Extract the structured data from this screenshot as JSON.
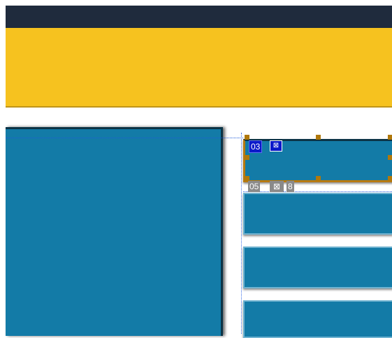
{
  "labels": {
    "selected_id": "03",
    "selected_icon": "image-icon",
    "next_id": "05",
    "next_icon": "image-icon",
    "next_suffix": "8"
  },
  "colors": {
    "dark_bar": "#1f2b3d",
    "yellow": "#f6c21f",
    "panel_blue": "#137ba7",
    "selection_blue": "#0a19c9",
    "handle_brown": "#b0780b"
  }
}
